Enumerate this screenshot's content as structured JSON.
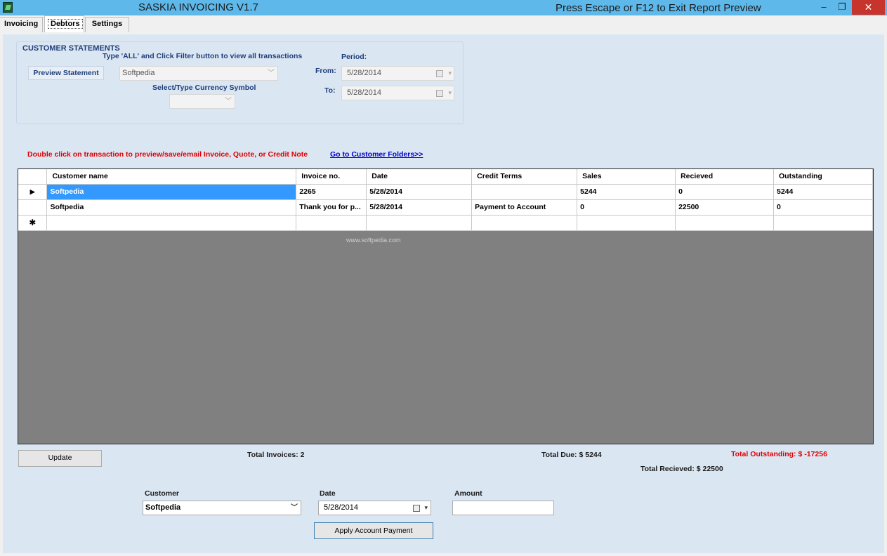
{
  "window": {
    "title": "SASKIA INVOICING V1.7",
    "hint": "Press Escape or F12 to Exit Report Preview",
    "minimize_glyph": "–",
    "maximize_glyph": "❐",
    "close_glyph": "✕",
    "icon": "app-logo-icon"
  },
  "tabs": [
    {
      "label": "Invoicing",
      "active": false
    },
    {
      "label": "Debtors",
      "active": true
    },
    {
      "label": "Settings",
      "active": false
    }
  ],
  "customer_statements": {
    "title": "CUSTOMER STATEMENTS",
    "instruction": "Type 'ALL' and Click Filter button to view all transactions",
    "preview_button": "Preview Statement",
    "customer_value": "Softpedia",
    "currency_label": "Select/Type Currency Symbol",
    "currency_value": "",
    "period_label": "Period:",
    "from_label": "From:",
    "from_value": "5/28/2014",
    "to_label": "To:",
    "to_value": "5/28/2014"
  },
  "note": "Double click on transaction to preview/save/email Invoice, Quote, or Credit Note",
  "folders_link": "Go to Customer Folders>>",
  "grid": {
    "columns": [
      "Customer name",
      "Invoice no.",
      "Date",
      "Credit Terms",
      "Sales",
      "Recieved",
      "Outstanding"
    ],
    "rows": [
      {
        "marker": "▶",
        "cells": [
          "Softpedia",
          "2265",
          "5/28/2014",
          "",
          "5244",
          "0",
          "5244"
        ]
      },
      {
        "marker": "",
        "cells": [
          "Softpedia",
          "Thank you for p...",
          "5/28/2014",
          "Payment to Account",
          "0",
          "22500",
          "0"
        ]
      },
      {
        "marker": "✱",
        "cells": [
          "",
          "",
          "",
          "",
          "",
          "",
          ""
        ]
      }
    ],
    "watermark": "www.softpedia.com"
  },
  "update_button": "Update",
  "totals": {
    "invoices": "Total Invoices: 2",
    "due": "Total Due: $ 5244",
    "outstanding": "Total Outstanding: $ -17256",
    "received": "Total Recieved: $ 22500"
  },
  "payment": {
    "customer_label": "Customer",
    "customer_value": "Softpedia",
    "date_label": "Date",
    "date_value": "5/28/2014",
    "amount_label": "Amount",
    "amount_value": "",
    "apply_button": "Apply Account Payment"
  },
  "colors": {
    "titlebar": "#5eb8ea",
    "panel": "#dbe6f3",
    "selection": "#3399ff",
    "alert": "#e00000",
    "close": "#c7342b"
  }
}
